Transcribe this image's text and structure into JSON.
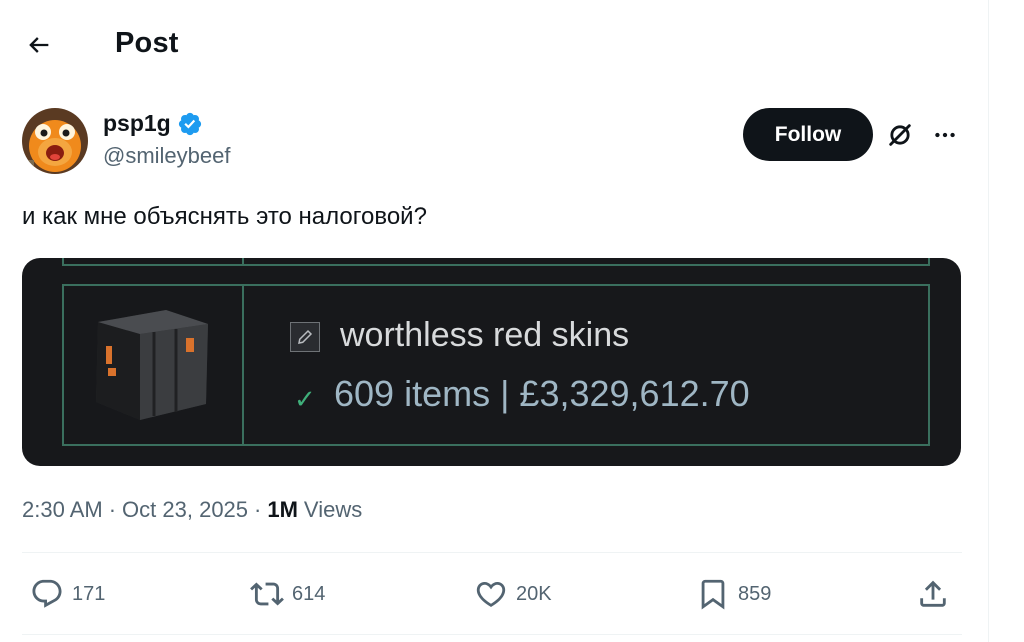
{
  "header": {
    "title": "Post",
    "back_icon": "arrow-left-icon"
  },
  "author": {
    "display_name": "psp1g",
    "handle": "@smileybeef",
    "verified": true,
    "verified_color": "#1d9bf0",
    "avatar_icon": "orange-character-avatar"
  },
  "actions_top": {
    "follow_label": "Follow",
    "grok_icon": "grok-icon",
    "more_icon": "more-dots-icon"
  },
  "post": {
    "text": "и как мне объяснять это налоговой?",
    "media": {
      "item_name": "worthless red skins",
      "item_stats": "609 items | £3,329,612.70",
      "check_icon": "checkmark-icon",
      "edit_icon": "pencil-icon",
      "accent_color": "#3a6f5e"
    }
  },
  "meta": {
    "time": "2:30 AM",
    "dot1": "·",
    "date": "Oct 23, 2025",
    "dot2": "·",
    "views_count": "1M",
    "views_label": "Views"
  },
  "engagement": {
    "replies": "171",
    "reposts": "614",
    "likes": "20K",
    "bookmarks": "859"
  },
  "colors": {
    "text_primary": "#0f1419",
    "text_secondary": "#536471",
    "divider": "#eff3f4"
  }
}
